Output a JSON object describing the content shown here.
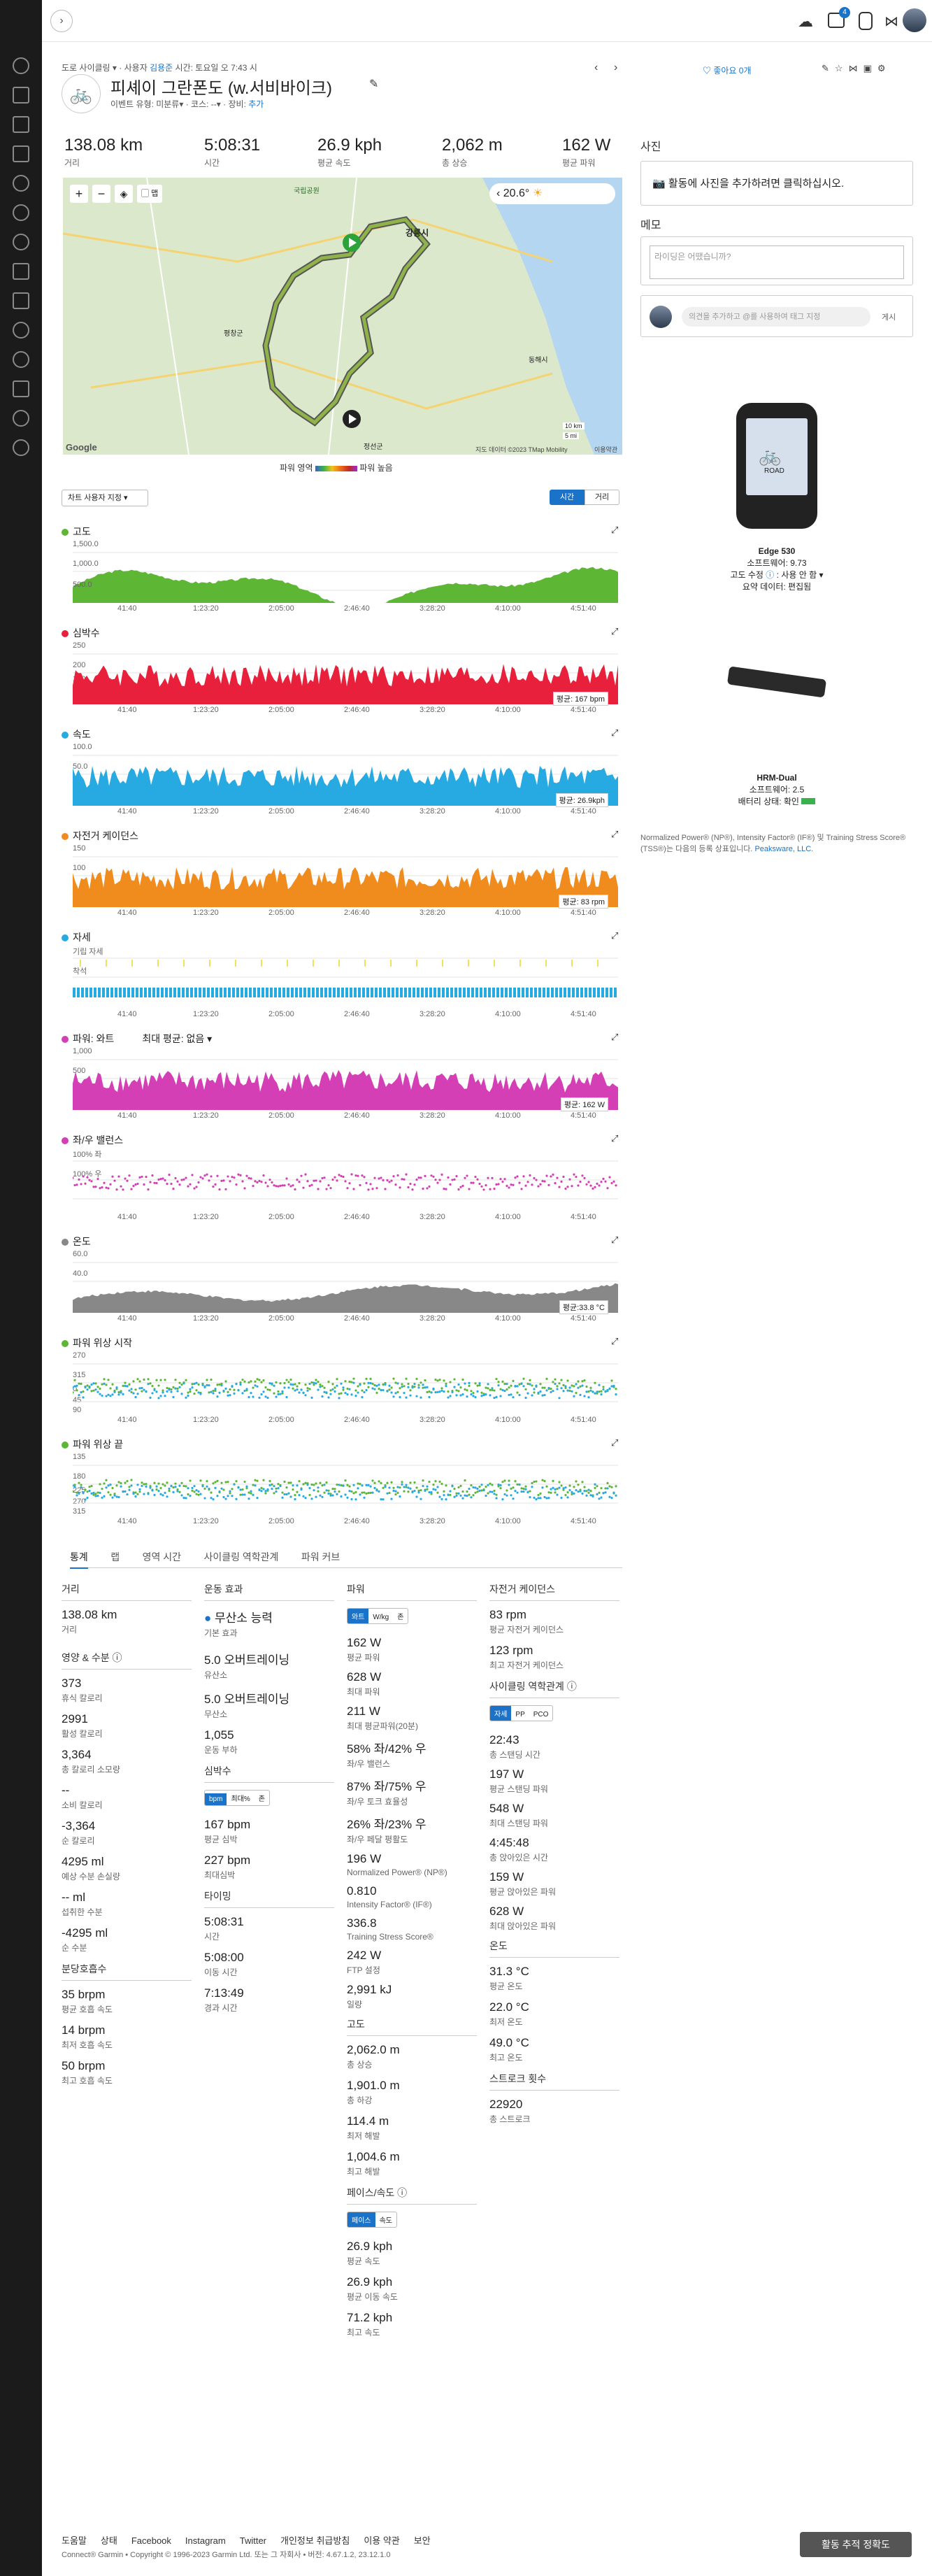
{
  "nav": {
    "badges": [
      "4"
    ]
  },
  "activity": {
    "breadcrumb": "도로 사이클링",
    "owner_prefix": "사용자",
    "owner": "김용준",
    "datetime": "시간: 토요일 오 7:43 시",
    "title": "피셰이 그란폰도 (w.서비바이크)",
    "event_type_label": "이벤트 유형:",
    "event_type": "미분류",
    "course_label": "코스:",
    "course": "--",
    "gear_label": "장비:",
    "gear": "추가",
    "like_label": "좋아요 0개"
  },
  "summary": [
    {
      "value": "138.08 km",
      "label": "거리"
    },
    {
      "value": "5:08:31",
      "label": "시간"
    },
    {
      "value": "26.9 kph",
      "label": "평균 속도"
    },
    {
      "value": "2,062 m",
      "label": "총 상승"
    },
    {
      "value": "162 W",
      "label": "평균 파워"
    }
  ],
  "map": {
    "temp": "20.6°",
    "label_city": "강릉시",
    "label_town1": "정선군",
    "label_town2": "평창군",
    "label_town3": "동해시",
    "label_park": "국립공원",
    "attrib": "지도 데이터 ©2023 TMap Mobility",
    "terms": "이용약관",
    "scale_km": "10 km",
    "scale_mi": "5 mi",
    "google": "Google",
    "layers_label": "맵"
  },
  "legend": {
    "left": "파워 영역",
    "right": "파워 높음"
  },
  "chart_options": {
    "select": "차트 사용자 지정",
    "toggle_time": "시간",
    "toggle_dist": "거리"
  },
  "x_ticks": [
    "41:40",
    "1:23:20",
    "2:05:00",
    "2:46:40",
    "3:28:20",
    "4:10:00",
    "4:51:40"
  ],
  "charts": [
    {
      "title": "고도",
      "color": "#5db634",
      "ymax": "1,500.0",
      "ymid": "1,000.0",
      "avg": "",
      "note": "500.0"
    },
    {
      "title": "심박수",
      "color": "#e8203c",
      "ymax": "250",
      "ymid": "200",
      "y3": "150",
      "avg": "평균: 167 bpm"
    },
    {
      "title": "속도",
      "color": "#27a9e1",
      "ymax": "100.0",
      "ymid": "50.0",
      "avg": "평균: 26.9kph"
    },
    {
      "title": "자전거 케이던스",
      "color": "#f08c1e",
      "ymax": "150",
      "ymid": "100",
      "avg": "평균: 83 rpm"
    },
    {
      "title": "자세",
      "color": "#27a9e1",
      "ymax": "기립 자세",
      "ymid": "착석",
      "avg": ""
    },
    {
      "title": "파워: 와트",
      "color": "#d43fb5",
      "ymax": "1,000",
      "ymid": "500",
      "avg": "평균: 162 W",
      "extra": "최대 평균: 없음"
    },
    {
      "title": "좌/우 밸런스",
      "color": "#d43fb5",
      "ymax": "100% 좌",
      "ymid": "100% 우",
      "avg": ""
    },
    {
      "title": "온도",
      "color": "#888888",
      "ymax": "60.0",
      "ymid": "40.0",
      "avg": "평균:33.8 °C"
    },
    {
      "title": "파워 위상 시작",
      "color": "#5db634",
      "ymax": "270",
      "ymid": "315",
      "y3": "0",
      "y4": "45",
      "y5": "90",
      "avg": ""
    },
    {
      "title": "파워 위상 끝",
      "color": "#5db634",
      "ymax": "135",
      "ymid": "180",
      "y3": "225",
      "y4": "270",
      "y5": "315",
      "avg": ""
    }
  ],
  "sidebar": {
    "photos_title": "사진",
    "photos_cta": "활동에 사진을 추가하려면 클릭하십시오.",
    "notes_title": "메모",
    "notes_placeholder": "라이딩은 어땠습니까?",
    "comment_placeholder": "의견을 추가하고 @를 사용하여 태그 지정",
    "comment_post": "게시",
    "device_name": "Edge 530",
    "device_sw": "소프트웨어: 9.73",
    "device_alt": "고도 수정",
    "device_alt_val": "사용 안 함",
    "device_summary": "요약 데이터: 편집됨",
    "device_screen": "ROAD",
    "hrm_name": "HRM-Dual",
    "hrm_sw": "소프트웨어: 2.5",
    "hrm_batt": "배터리 상태: 확인",
    "disclaimer": "Normalized Power® (NP®), Intensity Factor® (IF®) 및 Training Stress Score® (TSS®)는 다음의 등록 상표입니다.",
    "disclaimer_link": "Peaksware, LLC."
  },
  "stats_tabs": [
    "통계",
    "랩",
    "영역 시간",
    "사이클링 역학관계",
    "파워 커브"
  ],
  "col1": {
    "dist_head": "거리",
    "dist": "138.08 km",
    "dist_l": "거리",
    "nutri_head": "영양 & 수분",
    "items": [
      [
        "373",
        "휴식 칼로리"
      ],
      [
        "2991",
        "활성 칼로리"
      ],
      [
        "3,364",
        "총 칼로리 소모량"
      ],
      [
        "--",
        "소비 칼로리"
      ],
      [
        "-3,364",
        "순 칼로리"
      ],
      [
        "4295 ml",
        "예상 수분 손실량"
      ],
      [
        "-- ml",
        "섭취한 수분"
      ],
      [
        "-4295 ml",
        "순 수분"
      ]
    ],
    "resp_head": "분당호흡수",
    "resp": [
      [
        "35 brpm",
        "평균 호흡 속도"
      ],
      [
        "14 brpm",
        "최저 호흡 속도"
      ],
      [
        "50 brpm",
        "최고 호흡 속도"
      ]
    ]
  },
  "col2": {
    "effect_head": "운동 효과",
    "effect_primary": "무산소 능력",
    "effect_primary_l": "기본 효과",
    "items": [
      [
        "5.0 오버트레이닝",
        "유산소"
      ],
      [
        "5.0 오버트레이닝",
        "무산소"
      ],
      [
        "1,055",
        "운동 부하"
      ]
    ],
    "hr_head": "심박수",
    "hr_seg": [
      "bpm",
      "최대%",
      "존"
    ],
    "hr": [
      [
        "167 bpm",
        "평균 심박"
      ],
      [
        "227 bpm",
        "최대심박"
      ]
    ],
    "timing_head": "타이밍",
    "timing": [
      [
        "5:08:31",
        "시간"
      ],
      [
        "5:08:00",
        "이동 시간"
      ],
      [
        "7:13:49",
        "경과 시간"
      ]
    ]
  },
  "col3": {
    "power_head": "파워",
    "power_seg": [
      "와트",
      "W/kg",
      "존"
    ],
    "power": [
      [
        "162 W",
        "평균 파워"
      ],
      [
        "628 W",
        "최대 파워"
      ],
      [
        "211 W",
        "최대 평균파워(20분)"
      ],
      [
        "58% 좌/42% 우",
        "좌/우 밸런스"
      ],
      [
        "87% 좌/75% 우",
        "좌/우 토크 효율성"
      ],
      [
        "26% 좌/23% 우",
        "좌/우 페달 평활도"
      ],
      [
        "196 W",
        "Normalized Power® (NP®)"
      ],
      [
        "0.810",
        "Intensity Factor® (IF®)"
      ],
      [
        "336.8",
        "Training Stress Score®"
      ],
      [
        "242 W",
        "FTP 설정"
      ],
      [
        "2,991 kJ",
        "일량"
      ]
    ],
    "elev_head": "고도",
    "elev": [
      [
        "2,062.0 m",
        "총 상승"
      ],
      [
        "1,901.0 m",
        "총 하강"
      ],
      [
        "114.4 m",
        "최저 해발"
      ],
      [
        "1,004.6 m",
        "최고 해발"
      ]
    ],
    "pace_head": "페이스/속도",
    "pace_seg": [
      "페이스",
      "속도"
    ],
    "pace": [
      [
        "26.9 kph",
        "평균 속도"
      ],
      [
        "26.9 kph",
        "평균 이동 속도"
      ],
      [
        "71.2 kph",
        "최고 속도"
      ]
    ]
  },
  "col4": {
    "cad_head": "자전거 케이던스",
    "cad": [
      [
        "83 rpm",
        "평균 자전거 케이던스"
      ],
      [
        "123 rpm",
        "최고 자전거 케이던스"
      ]
    ],
    "dyn_head": "사이클링 역학관계",
    "dyn_seg": [
      "자세",
      "PP",
      "PCO"
    ],
    "dyn": [
      [
        "22:43",
        "총 스탠딩 시간"
      ],
      [
        "197 W",
        "평균 스탠딩 파워"
      ],
      [
        "548 W",
        "최대 스탠딩 파워"
      ],
      [
        "4:45:48",
        "총 앉아있은 시간"
      ],
      [
        "159 W",
        "평균 앉아있은 파워"
      ],
      [
        "628 W",
        "최대 앉아있은 파워"
      ]
    ],
    "temp_head": "온도",
    "temp": [
      [
        "31.3 °C",
        "평균 온도"
      ],
      [
        "22.0 °C",
        "최저 온도"
      ],
      [
        "49.0 °C",
        "최고 온도"
      ]
    ],
    "stroke_head": "스트로크 횟수",
    "stroke": [
      [
        "22920",
        "총 스트로크"
      ]
    ]
  },
  "footer": {
    "links": [
      "도움말",
      "상태",
      "Facebook",
      "Instagram",
      "Twitter",
      "개인정보 취급방침",
      "이용 약관",
      "보안"
    ],
    "copyright": "Connect® Garmin • Copyright © 1996-2023 Garmin Ltd. 또는 그 자회사 • 버전: 4.67.1.2, 23.12.1.0",
    "tracking_button": "활동 추적 정확도"
  }
}
